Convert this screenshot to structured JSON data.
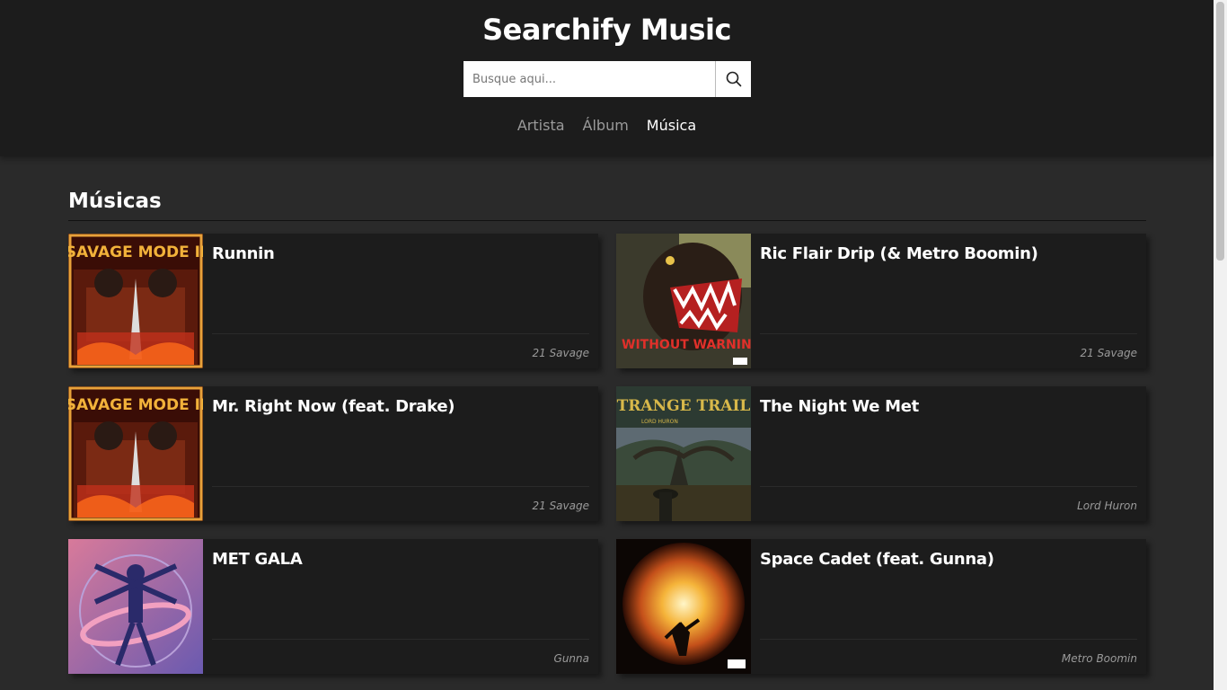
{
  "header": {
    "title": "Searchify Music",
    "search_placeholder": "Busque aqui...",
    "tabs": [
      "Artista",
      "Álbum",
      "Música"
    ],
    "active_tab": "Música"
  },
  "section": {
    "title": "Músicas"
  },
  "tracks": [
    {
      "name": "Runnin",
      "artist": "21 Savage",
      "cover": "savage-mode-ii-cover"
    },
    {
      "name": "Ric Flair Drip (& Metro Boomin)",
      "artist": "21 Savage",
      "cover": "without-warning-cover"
    },
    {
      "name": "Mr. Right Now (feat. Drake)",
      "artist": "21 Savage",
      "cover": "savage-mode-ii-cover"
    },
    {
      "name": "The Night We Met",
      "artist": "Lord Huron",
      "cover": "strange-trails-cover"
    },
    {
      "name": "MET GALA",
      "artist": "Gunna",
      "cover": "drip-season-cover"
    },
    {
      "name": "Space Cadet (feat. Gunna)",
      "artist": "Metro Boomin",
      "cover": "not-all-heroes-cover"
    }
  ],
  "cover_text": {
    "savage_mode": "SAVAGE MODE II",
    "without_warning": "WITHOUT WARNING",
    "strange_trails": "STRANGE TRAILS",
    "lord_huron": "LORD HURON"
  },
  "colors": {
    "header_bg": "#1c1c1c",
    "page_bg": "#2a2a2a",
    "card_bg": "#1c1c1c",
    "muted": "#9a9a9a"
  }
}
